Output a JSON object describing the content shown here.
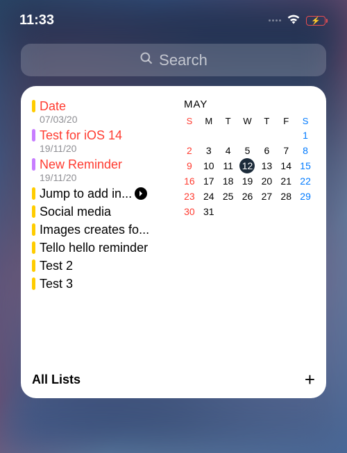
{
  "status": {
    "time": "11:33"
  },
  "search": {
    "placeholder": "Search"
  },
  "reminders": [
    {
      "title": "Date",
      "date": "07/03/20",
      "color": "yellow",
      "titleColor": "red"
    },
    {
      "title": "Test for iOS 14",
      "date": "19/11/20",
      "color": "purple",
      "titleColor": "red"
    },
    {
      "title": "New Reminder",
      "date": "19/11/20",
      "color": "purple",
      "titleColor": "red"
    },
    {
      "title": "Jump to add in...",
      "date": "",
      "color": "yellow",
      "titleColor": "black",
      "chevron": true
    },
    {
      "title": "Social media",
      "date": "",
      "color": "yellow",
      "titleColor": "black"
    },
    {
      "title": "Images creates fo...",
      "date": "",
      "color": "yellow",
      "titleColor": "black"
    },
    {
      "title": "Tello hello reminder",
      "date": "",
      "color": "yellow",
      "titleColor": "black"
    },
    {
      "title": "Test 2",
      "date": "",
      "color": "yellow",
      "titleColor": "black"
    },
    {
      "title": "Test 3",
      "date": "",
      "color": "yellow",
      "titleColor": "black"
    }
  ],
  "calendar": {
    "month": "MAY",
    "headers": [
      "S",
      "M",
      "T",
      "W",
      "T",
      "F",
      "S"
    ],
    "days": [
      [
        "",
        "",
        "",
        "",
        "",
        "",
        "1"
      ],
      [
        "2",
        "3",
        "4",
        "5",
        "6",
        "7",
        "8"
      ],
      [
        "9",
        "10",
        "11",
        "12",
        "13",
        "14",
        "15"
      ],
      [
        "16",
        "17",
        "18",
        "19",
        "20",
        "21",
        "22"
      ],
      [
        "23",
        "24",
        "25",
        "26",
        "27",
        "28",
        "29"
      ],
      [
        "30",
        "31",
        "",
        "",
        "",
        "",
        ""
      ]
    ],
    "today": "12"
  },
  "footer": {
    "label": "All Lists",
    "plus": "+"
  }
}
